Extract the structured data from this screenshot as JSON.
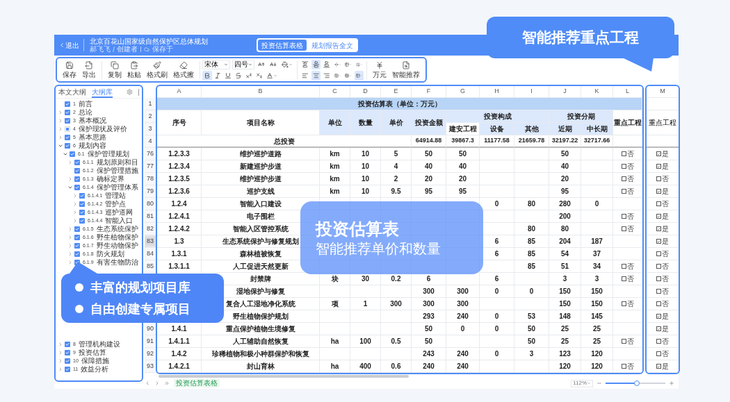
{
  "header": {
    "back": "退出",
    "title": "北京百花山国家级自然保护区总体规划",
    "author": "郝飞飞",
    "role": "创建者",
    "save_status": "保存于",
    "views": [
      {
        "label": "投资估算表格",
        "selected": true
      },
      {
        "label": "规划报告全文",
        "selected": false
      }
    ]
  },
  "toolbar": {
    "file_actions": [
      {
        "label": "保存"
      },
      {
        "label": "导出"
      }
    ],
    "edit_actions": [
      {
        "label": "复制"
      },
      {
        "label": "粘贴"
      },
      {
        "label": "格式刷"
      },
      {
        "label": "格式擦"
      }
    ],
    "font_family": "宋体",
    "font_size": "四号",
    "text_styles": [
      {
        "selected": true
      },
      {
        "selected": false
      },
      {
        "selected": false
      },
      {
        "selected": false
      },
      {
        "selected": false
      },
      {
        "selected": false
      }
    ],
    "align_options": [
      {
        "selected": false
      },
      {
        "selected": true
      },
      {
        "selected": false
      },
      {
        "selected": false
      },
      {
        "selected": false
      },
      {
        "selected": false
      },
      {
        "selected": false
      },
      {
        "selected": true
      },
      {
        "selected": false
      },
      {
        "selected": false
      },
      {
        "selected": false
      },
      {
        "selected": true
      }
    ],
    "extra_actions": [
      {
        "label": "万元"
      },
      {
        "label": "智能推荐"
      }
    ]
  },
  "sidebar": {
    "tabs": [
      {
        "label": "本文大纲",
        "selected": false
      },
      {
        "label": "大纲库",
        "selected": true
      }
    ],
    "tree_sections": [
      {
        "items": [
          {
            "number": "1",
            "label": "前言",
            "checked": true,
            "expandable": false,
            "expanded": false
          },
          {
            "number": "2",
            "label": "总论",
            "checked": true,
            "expandable": true,
            "expanded": false
          },
          {
            "number": "3",
            "label": "基本概况",
            "checked": true,
            "expandable": true,
            "expanded": false
          },
          {
            "number": "4",
            "label": "保护现状及评价",
            "checked": false,
            "expandable": true,
            "expanded": false
          },
          {
            "number": "5",
            "label": "基本思路",
            "checked": true,
            "expandable": true,
            "expanded": false
          },
          {
            "number": "6",
            "label": "规划内容",
            "checked": true,
            "expandable": true,
            "expanded": true,
            "children": [
              {
                "number": "6.1",
                "label": "保护管理规划",
                "checked": true,
                "expandable": true,
                "expanded": true,
                "children": [
                  {
                    "number": "6.1.1",
                    "label": "规划原则和目",
                    "checked": true,
                    "expandable": true,
                    "expanded": false
                  },
                  {
                    "number": "6.1.2",
                    "label": "保护管理措施",
                    "checked": true,
                    "expandable": false,
                    "expanded": false
                  },
                  {
                    "number": "6.1.3",
                    "label": "确标定界",
                    "checked": true,
                    "expandable": true,
                    "expanded": false
                  },
                  {
                    "number": "6.1.4",
                    "label": "保护管理体系",
                    "checked": true,
                    "expandable": true,
                    "expanded": true,
                    "children": [
                      {
                        "number": "6.1.4.1",
                        "label": "管理站",
                        "checked": true,
                        "expandable": true,
                        "expanded": false
                      },
                      {
                        "number": "6.1.4.2",
                        "label": "管护点",
                        "checked": true,
                        "expandable": true,
                        "expanded": false
                      },
                      {
                        "number": "6.1.4.3",
                        "label": "巡护道网",
                        "checked": true,
                        "expandable": true,
                        "expanded": false
                      },
                      {
                        "number": "6.1.4.4",
                        "label": "智能入口",
                        "checked": true,
                        "expandable": true,
                        "expanded": false
                      }
                    ]
                  },
                  {
                    "number": "6.1.5",
                    "label": "生态系统保护",
                    "checked": true,
                    "expandable": true,
                    "expanded": false
                  },
                  {
                    "number": "6.1.6",
                    "label": "野生植物保护",
                    "checked": true,
                    "expandable": true,
                    "expanded": false
                  },
                  {
                    "number": "6.1.7",
                    "label": "野生动物保护",
                    "checked": true,
                    "expandable": true,
                    "expanded": false
                  },
                  {
                    "number": "6.1.8",
                    "label": "防火规划",
                    "checked": true,
                    "expandable": true,
                    "expanded": false
                  },
                  {
                    "number": "6.1.9",
                    "label": "有害生物防治",
                    "checked": true,
                    "expandable": true,
                    "expanded": false
                  }
                ]
              }
            ]
          }
        ]
      },
      {
        "items": [
          {
            "number": "8",
            "label": "管理机构建设",
            "checked": true,
            "expandable": true,
            "expanded": false
          },
          {
            "number": "9",
            "label": "投资估算",
            "checked": true,
            "expandable": true,
            "expanded": false
          },
          {
            "number": "10",
            "label": "保障措施",
            "checked": true,
            "expandable": true,
            "expanded": false
          },
          {
            "number": "11",
            "label": "效益分析",
            "checked": true,
            "expandable": true,
            "expanded": false
          }
        ]
      }
    ]
  },
  "sheet": {
    "columns": [
      "A",
      "B",
      "C",
      "D",
      "E",
      "F",
      "G",
      "H",
      "I",
      "J",
      "K",
      "L"
    ],
    "key_column": "M",
    "header_row_numbers": [
      "1",
      "2",
      "3",
      "4"
    ],
    "title": "投资估算表（单位：万元）",
    "headers": {
      "no": "序号",
      "name": "项目名称",
      "unit": "单位",
      "qty": "数量",
      "price": "单价",
      "amount": "投资金额",
      "composition": "投资构成",
      "phasing": "投资分期",
      "key": "重点工程",
      "construction": "建安工程",
      "equipment": "设备",
      "other": "其他",
      "near": "近期",
      "long": "中长期"
    },
    "key_header": "重点工程",
    "total": {
      "label": "总投资",
      "amount": "64914.88",
      "construction": "39867.3",
      "equipment": "11177.58",
      "other": "21659.78",
      "near": "32197.22",
      "long": "32717.66"
    },
    "rows": [
      {
        "row": "76",
        "selected": false,
        "no": "1.2.3.3",
        "name": "维护巡护道路",
        "unit": "km",
        "qty": "10",
        "price": "5",
        "amount": "50",
        "construction": "50",
        "near": "50",
        "key": {
          "checked": false,
          "label": "否"
        },
        "key_m": {
          "checked": true,
          "label": "是"
        }
      },
      {
        "row": "77",
        "selected": false,
        "no": "1.2.3.4",
        "name": "新建巡护步道",
        "unit": "km",
        "qty": "10",
        "price": "4",
        "amount": "40",
        "construction": "40",
        "near": "40",
        "key": {
          "checked": false,
          "label": "否"
        },
        "key_m": {
          "checked": true,
          "label": "是"
        }
      },
      {
        "row": "78",
        "selected": false,
        "no": "1.2.3.5",
        "name": "维护巡护步道",
        "unit": "km",
        "qty": "10",
        "price": "2",
        "amount": "20",
        "construction": "20",
        "near": "20",
        "key": {
          "checked": false,
          "label": "否"
        },
        "key_m": {
          "checked": false,
          "label": "否"
        }
      },
      {
        "row": "79",
        "selected": false,
        "no": "1.2.3.6",
        "name": "巡护支线",
        "unit": "km",
        "qty": "10",
        "price": "9.5",
        "amount": "95",
        "construction": "95",
        "near": "95",
        "key": {
          "checked": false,
          "label": "否"
        },
        "key_m": {
          "checked": true,
          "label": "是"
        }
      },
      {
        "row": "80",
        "selected": false,
        "no": "1.2.4",
        "name": "智能入口建设",
        "equipment": "0",
        "other": "80",
        "near": "280",
        "long": "0",
        "key_m": {
          "checked": false,
          "label": "否"
        }
      },
      {
        "row": "81",
        "selected": false,
        "no": "1.2.4.1",
        "name": "电子围栏",
        "near": "200",
        "key": {
          "checked": false,
          "label": "否"
        },
        "key_m": {
          "checked": true,
          "label": "是"
        }
      },
      {
        "row": "82",
        "selected": false,
        "no": "1.2.4.2",
        "name": "智能入区管控系统",
        "other": "80",
        "near": "80",
        "key": {
          "checked": false,
          "label": "否"
        },
        "key_m": {
          "checked": true,
          "label": "是"
        }
      },
      {
        "row": "83",
        "selected": true,
        "no": "1.3",
        "name": "生态系统保护与修复规划",
        "equipment": "6",
        "other": "85",
        "near": "204",
        "long": "187",
        "key_m": {
          "checked": true,
          "label": "是"
        }
      },
      {
        "row": "84",
        "selected": false,
        "no": "1.3.1",
        "name": "森林植被恢复",
        "equipment": "6",
        "other": "85",
        "near": "54",
        "long": "37",
        "key_m": {
          "checked": false,
          "label": "否"
        }
      },
      {
        "row": "85",
        "selected": false,
        "no": "1.3.1.1",
        "name": "人工促进天然更新",
        "other": "85",
        "near": "51",
        "long": "34",
        "key": {
          "checked": false,
          "label": "否"
        },
        "key_m": {
          "checked": false,
          "label": "否"
        }
      },
      {
        "name": "封禁牌",
        "unit": "块",
        "qty": "30",
        "price": "0.2",
        "amount": "6",
        "equipment": "6",
        "near": "3",
        "long": "3",
        "key": {
          "checked": false,
          "label": "否"
        },
        "key_m": {
          "checked": false,
          "label": "否"
        }
      },
      {
        "name": "湿地保护与修复",
        "amount": "300",
        "construction": "300",
        "equipment": "0",
        "other": "0",
        "near": "150",
        "long": "150",
        "key_m": {
          "checked": false,
          "label": "否"
        }
      },
      {
        "name": "复合人工湿地净化系统",
        "unit": "项",
        "qty": "1",
        "price": "300",
        "amount": "300",
        "construction": "300",
        "near": "150",
        "long": "150",
        "key": {
          "checked": false,
          "label": "否"
        },
        "key_m": {
          "checked": false,
          "label": "否"
        }
      },
      {
        "name": "野生植物保护规划",
        "amount": "293",
        "construction": "240",
        "equipment": "0",
        "other": "53",
        "near": "148",
        "long": "145",
        "key_m": {
          "checked": true,
          "label": "是"
        }
      },
      {
        "row": "90",
        "selected": false,
        "no": "1.4.1",
        "name": "重点保护植物生境修复",
        "amount": "50",
        "construction": "0",
        "equipment": "0",
        "other": "50",
        "near": "25",
        "long": "25",
        "key_m": {
          "checked": true,
          "label": "是"
        }
      },
      {
        "row": "91",
        "selected": false,
        "no": "1.4.1.1",
        "name": "人工辅助自然恢复",
        "unit": "ha",
        "qty": "100",
        "price": "0.5",
        "amount": "50",
        "other": "50",
        "near": "25",
        "long": "25",
        "key": {
          "checked": false,
          "label": "否"
        },
        "key_m": {
          "checked": false,
          "label": "否"
        }
      },
      {
        "row": "92",
        "selected": false,
        "no": "1.4.2",
        "name": "珍稀植物和极小种群保护和恢复",
        "amount": "243",
        "construction": "240",
        "equipment": "0",
        "other": "3",
        "near": "123",
        "long": "120",
        "key_m": {
          "checked": false,
          "label": "否"
        }
      },
      {
        "row": "93",
        "selected": false,
        "no": "1.4.2.1",
        "name": "封山育林",
        "unit": "ha",
        "qty": "400",
        "price": "0.6",
        "amount": "240",
        "construction": "240",
        "near": "120",
        "long": "120",
        "key": {
          "checked": false,
          "label": "否"
        },
        "key_m": {
          "checked": true,
          "label": "是"
        }
      }
    ]
  },
  "bottom_bar": {
    "sheet_tab": "投资估算表格",
    "zoom": "112%",
    "level": 0.52
  },
  "callouts": [
    {
      "kind": "headline",
      "text": "智能推荐重点工程"
    },
    {
      "kind": "title",
      "title": "投资估算表",
      "subtitle": "智能推荐单价和数量"
    },
    {
      "kind": "bullets",
      "bullets": [
        "丰富的规划项目库",
        "自由创建专属项目"
      ]
    }
  ]
}
